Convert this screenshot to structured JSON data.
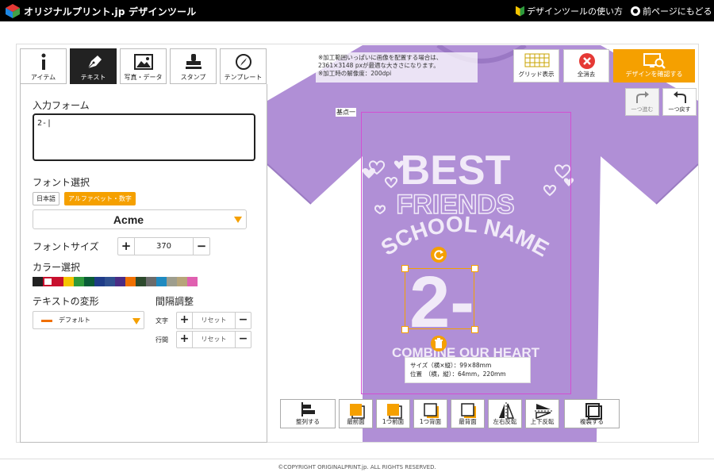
{
  "header": {
    "brand": "オリジナルプリント.jp デザインツール",
    "help_link": "デザインツールの使い方",
    "back_link": "前ページにもどる"
  },
  "tabs": [
    {
      "label": "アイテム",
      "icon": "info-icon"
    },
    {
      "label": "テキスト",
      "icon": "pen-icon",
      "active": true
    },
    {
      "label": "写真・データ",
      "icon": "image-icon"
    },
    {
      "label": "スタンプ",
      "icon": "stamp-icon"
    },
    {
      "label": "テンプレート",
      "icon": "compass-icon"
    }
  ],
  "panel": {
    "input_label": "入力フォーム",
    "input_value": "2-",
    "font_label": "フォント選択",
    "font_tab_ja": "日本語",
    "font_tab_alpha": "アルファベット・数字",
    "font_value": "Acme",
    "size_label": "フォントサイズ",
    "size_value": "370",
    "color_label": "カラー選択",
    "palette": [
      "#222222",
      "#ffffff",
      "#c8102e",
      "#f5c400",
      "#2e9a3b",
      "#0a5c36",
      "#1f3c88",
      "#2f4f8f",
      "#4b2c84",
      "#f07000",
      "#2d4a2d",
      "#6b6b6b",
      "#1f8ac0",
      "#9e9e8e",
      "#b7a57a",
      "#e060b0"
    ],
    "selected_color": "#ffffff",
    "transform_label": "テキストの変形",
    "transform_value": "デフォルト",
    "spacing_label": "間隔調整",
    "char_label": "文字",
    "line_label": "行間",
    "reset": "リセット"
  },
  "canvas": {
    "shirt_color": "#b08fd6",
    "note_lines": [
      "※加工範囲いっぱいに画像を配置する場合は、",
      "2361×3148 pxが最適な大きさになります。",
      "※加工時の解像度：200dpi"
    ],
    "grid_label": "グリッド表示",
    "clear_label": "全消去",
    "confirm_label": "デザインを確認する",
    "redo_label": "一つ進む",
    "undo_label": "一つ戻す",
    "area_label": "基点一",
    "design": {
      "best": "BEST",
      "friends": "FRIENDS",
      "school": "SCHOOL NAME",
      "number": "2-",
      "heart_line": "COMBINE OUR HEART"
    },
    "info_size": "サイズ（横×縦）：99×88mm",
    "info_pos": "位置　（横，縦）：64mm，220mm"
  },
  "toolbar": {
    "align": "整列する",
    "front": "最前面",
    "forward": "1つ前面",
    "backward": "1つ背面",
    "back": "最背面",
    "flip_h": "左右反転",
    "flip_v": "上下反転",
    "duplicate": "複製する"
  },
  "footer": "©COPYRIGHT ORIGINALPRINT.jp. ALL RIGHTS RESERVED."
}
